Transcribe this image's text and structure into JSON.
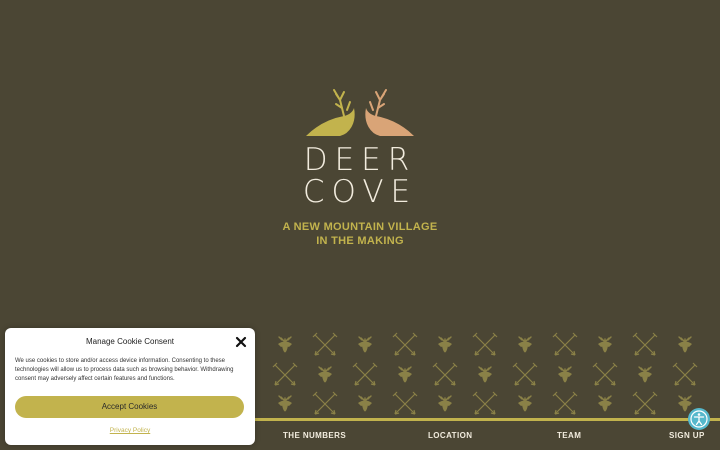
{
  "brand": {
    "name_line1": "DEER",
    "name_line2": "COVE",
    "tagline_line1": "A NEW MOUNTAIN VILLAGE",
    "tagline_line2": "IN THE MAKING",
    "colors": {
      "background": "#4b4634",
      "gold": "#c2b34d",
      "copper": "#d9a477",
      "cream": "#f2ecde",
      "accessibility_blue": "#55b8cc"
    }
  },
  "nav": {
    "items": [
      {
        "label": "THE NUMBERS"
      },
      {
        "label": "LOCATION"
      },
      {
        "label": "TEAM"
      },
      {
        "label": "SIGN UP"
      }
    ]
  },
  "cookie_banner": {
    "title": "Manage Cookie Consent",
    "body": "We use cookies to store and/or access device information. Consenting to these technologies will allow us to process data such as browsing behavior. Withdrawing consent may adversely affect certain features and functions.",
    "accept_label": "Accept Cookies",
    "privacy_label": "Privacy Policy",
    "close_icon": "close-icon"
  },
  "accessibility": {
    "icon": "accessibility-icon"
  }
}
